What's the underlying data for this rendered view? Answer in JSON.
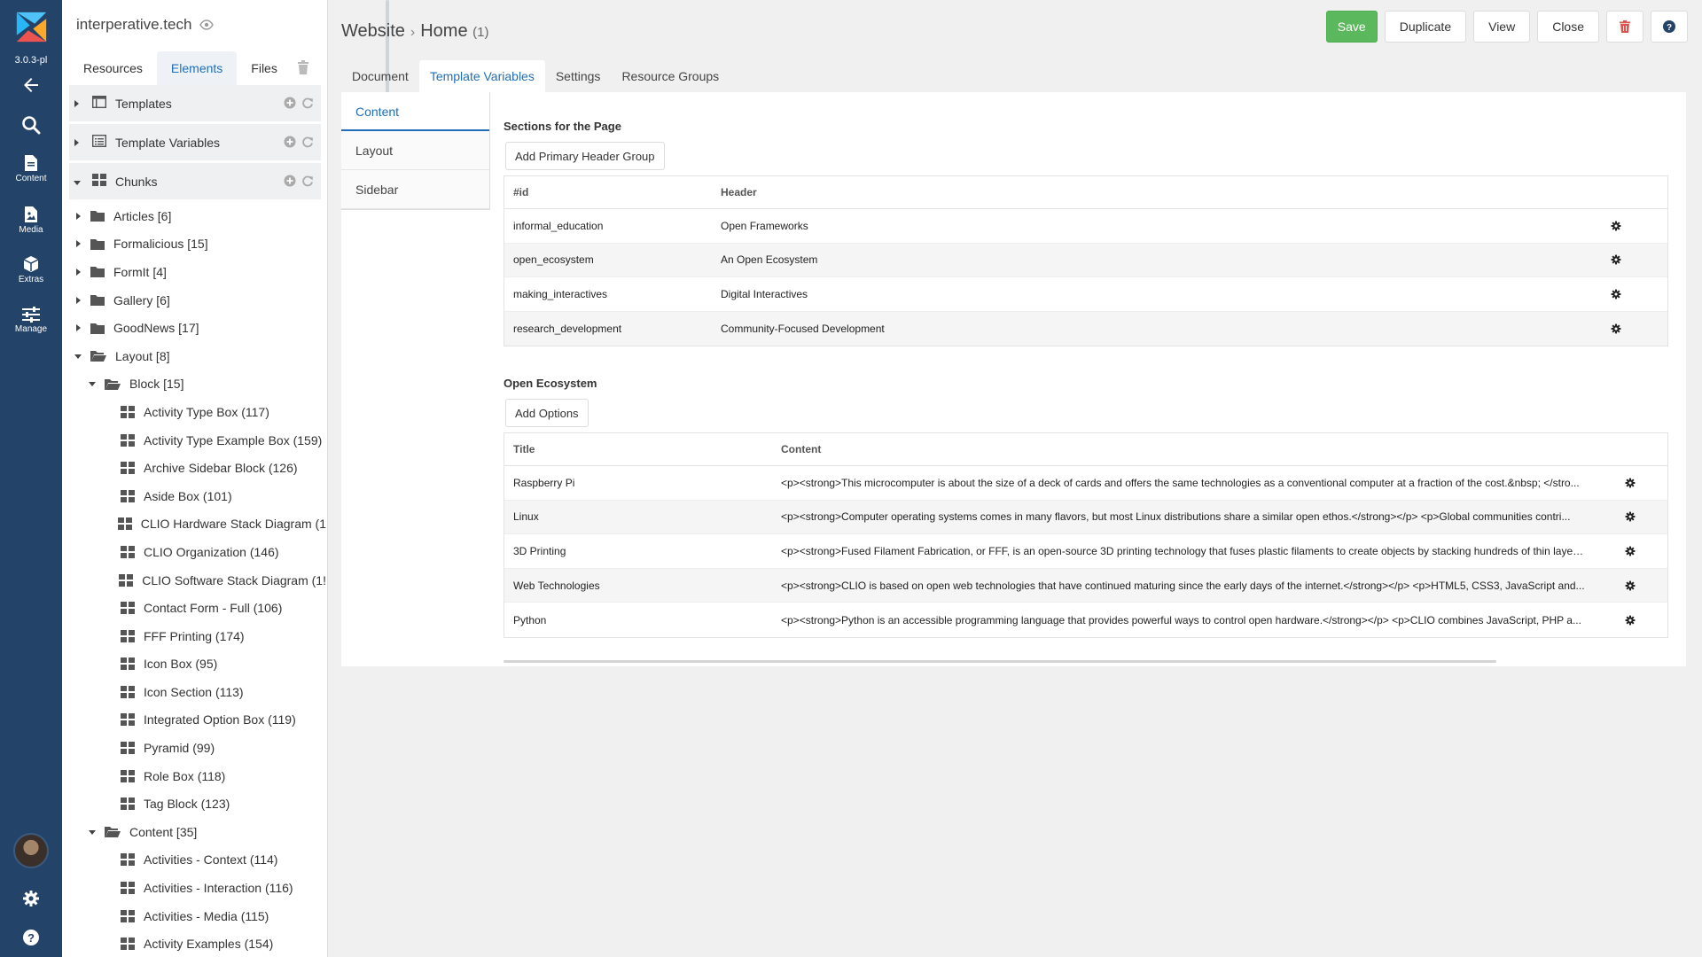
{
  "rail": {
    "version": "3.0.3-pl",
    "items": [
      {
        "label": ""
      },
      {
        "label": ""
      },
      {
        "label": "Content"
      },
      {
        "label": "Media"
      },
      {
        "label": "Extras"
      },
      {
        "label": "Manage"
      }
    ]
  },
  "tree": {
    "site_title": "interperative.tech",
    "tabs": [
      "Resources",
      "Elements",
      "Files"
    ],
    "sections": [
      {
        "label": "Templates",
        "icon": "templates-icon"
      },
      {
        "label": "Template Variables",
        "icon": "template-variables-icon"
      },
      {
        "label": "Chunks",
        "icon": "chunks-icon"
      }
    ],
    "nodes": [
      {
        "label": "Articles [6]",
        "type": "folder"
      },
      {
        "label": "Formalicious [15]",
        "type": "folder"
      },
      {
        "label": "FormIt [4]",
        "type": "folder"
      },
      {
        "label": "Gallery [6]",
        "type": "folder"
      },
      {
        "label": "GoodNews [17]",
        "type": "folder"
      },
      {
        "label": "Layout [8]",
        "type": "folder-open"
      },
      {
        "label": "Block [15]",
        "type": "subfolder-open"
      },
      {
        "label": "Activity Type Box (117)",
        "type": "chunk"
      },
      {
        "label": "Activity Type Example Box (159)",
        "type": "chunk"
      },
      {
        "label": "Archive Sidebar Block (126)",
        "type": "chunk"
      },
      {
        "label": "Aside Box (101)",
        "type": "chunk"
      },
      {
        "label": "CLIO Hardware Stack Diagram (1",
        "type": "chunk"
      },
      {
        "label": "CLIO Organization (146)",
        "type": "chunk"
      },
      {
        "label": "CLIO Software Stack Diagram (1!",
        "type": "chunk"
      },
      {
        "label": "Contact Form - Full (106)",
        "type": "chunk"
      },
      {
        "label": "FFF Printing (174)",
        "type": "chunk"
      },
      {
        "label": "Icon Box (95)",
        "type": "chunk"
      },
      {
        "label": "Icon Section (113)",
        "type": "chunk"
      },
      {
        "label": "Integrated Option Box (119)",
        "type": "chunk"
      },
      {
        "label": "Pyramid (99)",
        "type": "chunk"
      },
      {
        "label": "Role Box (118)",
        "type": "chunk"
      },
      {
        "label": "Tag Block (123)",
        "type": "chunk"
      },
      {
        "label": "Content [35]",
        "type": "subfolder-open"
      },
      {
        "label": "Activities - Context (114)",
        "type": "chunk"
      },
      {
        "label": "Activities - Interaction (116)",
        "type": "chunk"
      },
      {
        "label": "Activities - Media (115)",
        "type": "chunk"
      },
      {
        "label": "Activity Examples (154)",
        "type": "chunk"
      }
    ]
  },
  "header": {
    "crumb_root": "Website",
    "crumb_page": "Home",
    "crumb_count": "(1)",
    "buttons": {
      "save": "Save",
      "duplicate": "Duplicate",
      "view": "View",
      "close": "Close"
    }
  },
  "doc_tabs": [
    "Document",
    "Template Variables",
    "Settings",
    "Resource Groups"
  ],
  "tv_tabs": [
    "Content",
    "Layout",
    "Sidebar"
  ],
  "sections_grid": {
    "title": "Sections for the Page",
    "add_button": "Add Primary Header Group",
    "columns": [
      "#id",
      "Header"
    ],
    "rows": [
      {
        "id": "informal_education",
        "header": "Open Frameworks"
      },
      {
        "id": "open_ecosystem",
        "header": "An Open Ecosystem"
      },
      {
        "id": "making_interactives",
        "header": "Digital Interactives"
      },
      {
        "id": "research_development",
        "header": "Community-Focused Development"
      }
    ]
  },
  "options_grid": {
    "title": "Open Ecosystem",
    "add_button": "Add Options",
    "columns": [
      "Title",
      "Content"
    ],
    "rows": [
      {
        "title": "Raspberry Pi",
        "content": "<p><strong>This microcomputer is about the size of a deck of cards and offers the same technologies as a conventional computer at a fraction of the cost.&nbsp; </stro..."
      },
      {
        "title": "Linux",
        "content": "<p><strong>Computer operating systems comes in many flavors, but most Linux distributions share a similar open ethos.</strong></p> <p>Global communities contri..."
      },
      {
        "title": "3D Printing",
        "content": "<p><strong>Fused Filament Fabrication, or FFF, is an open-source 3D printing technology that fuses plastic filaments to create objects by stacking hundreds of thin layers..."
      },
      {
        "title": "Web Technologies",
        "content": "<p><strong>CLIO is based on open web technologies that have continued maturing since the early days of the internet.</strong></p> <p>HTML5, CSS3, JavaScript and..."
      },
      {
        "title": "Python",
        "content": "<p><strong>Python is an accessible programming language that provides powerful ways to control open hardware.</strong></p> <p>CLIO combines JavaScript, PHP a..."
      }
    ]
  },
  "colors": {
    "rail": "#234368",
    "accent": "#1e6fb8",
    "save": "#5cb85c",
    "delete": "#d9534f"
  }
}
